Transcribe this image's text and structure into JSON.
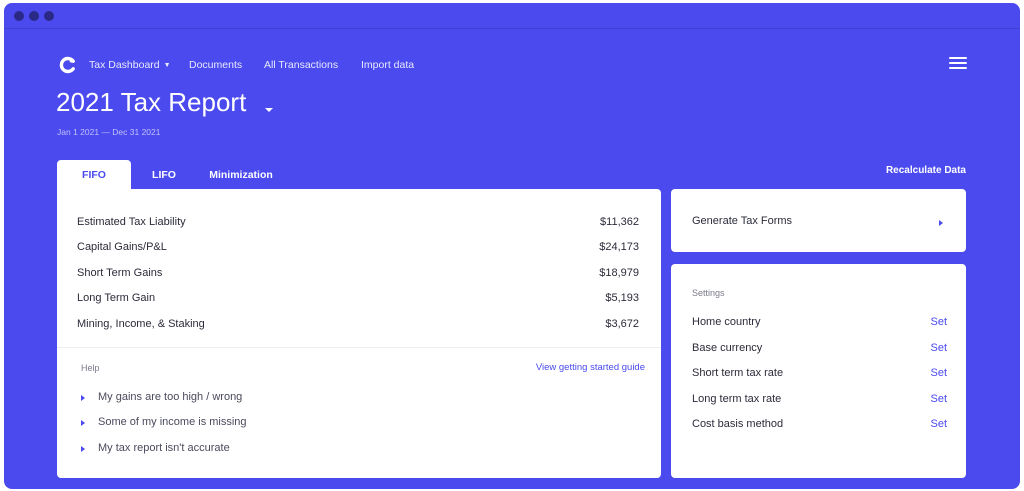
{
  "nav": {
    "logo_icon": "brand-logo-icon",
    "items": [
      {
        "label": "Tax Dashboard",
        "has_dropdown": true
      },
      {
        "label": "Documents"
      },
      {
        "label": "All Transactions"
      },
      {
        "label": "Import data"
      }
    ],
    "menu_icon": "hamburger-icon"
  },
  "header": {
    "title": "2021 Tax Report",
    "title_dropdown_icon": "chevron-down-icon",
    "date_range": "Jan 1 2021 — Dec 31 2021"
  },
  "tabs": [
    {
      "label": "FIFO",
      "active": true
    },
    {
      "label": "LIFO",
      "active": false
    },
    {
      "label": "Minimization",
      "active": false
    }
  ],
  "recalculate_label": "Recalculate Data",
  "summary": {
    "rows": [
      {
        "label": "Estimated Tax Liability",
        "value": "$11,362"
      },
      {
        "label": "Capital Gains/P&L",
        "value": "$24,173"
      },
      {
        "label": "Short Term Gains",
        "value": "$18,979"
      },
      {
        "label": "Long Term Gain",
        "value": "$5,193"
      },
      {
        "label": "Mining, Income, & Staking",
        "value": "$3,672"
      }
    ]
  },
  "help": {
    "label": "Help",
    "guide_link": "View getting started guide",
    "items": [
      {
        "label": "My gains are too high / wrong"
      },
      {
        "label": "Some of my income is missing"
      },
      {
        "label": "My tax report isn't accurate"
      }
    ]
  },
  "forms": {
    "label": "Generate Tax Forms",
    "icon": "caret-right-icon"
  },
  "settings": {
    "title": "Settings",
    "rows": [
      {
        "label": "Home country",
        "action": "Set"
      },
      {
        "label": "Base currency",
        "action": "Set"
      },
      {
        "label": "Short term tax rate",
        "action": "Set"
      },
      {
        "label": "Long term tax rate",
        "action": "Set"
      },
      {
        "label": "Cost basis method",
        "action": "Set"
      }
    ]
  },
  "colors": {
    "brand": "#4a4aee",
    "card_bg": "#ffffff",
    "text": "#2b2b3a"
  }
}
